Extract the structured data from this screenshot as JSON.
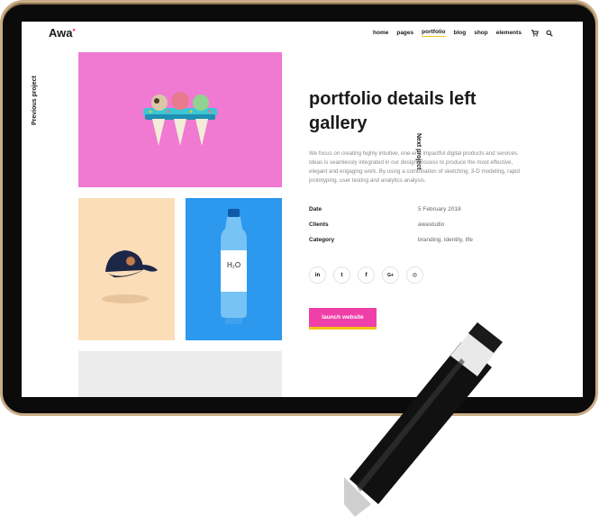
{
  "header": {
    "logo_text": "Awa",
    "logo_dot": "•",
    "nav": [
      "home",
      "pages",
      "portfolio",
      "blog",
      "shop",
      "elements"
    ],
    "active_nav": "portfolio",
    "icons": [
      "cart-icon",
      "search-icon"
    ]
  },
  "side": {
    "previous": "Previous project",
    "next": "Next project"
  },
  "detail": {
    "title": "portfolio details left gallery",
    "description": "We focus on creating highly intuitive, one-end impactful digital products and services. Ideas is seamlessly integrated in our design process to produce the most effective, elegant and engaging work. By using a combination of sketching, 3-D modeling, rapid prototyping, user testing and analytics analysis.",
    "info": [
      {
        "label": "Date",
        "value": "5 February 2018"
      },
      {
        "label": "Clients",
        "value": "awastudio"
      },
      {
        "label": "Category",
        "value": "branding, identity, life"
      }
    ],
    "social": [
      "linkedin-icon",
      "twitter-icon",
      "facebook-icon",
      "google-plus-icon",
      "instagram-icon"
    ],
    "social_glyphs": [
      "in",
      "t",
      "f",
      "G+",
      "◎"
    ],
    "launch_label": "launch website"
  },
  "images": {
    "bottle_text": "H₂O"
  },
  "colors": {
    "accent_pink": "#f03fa8",
    "accent_yellow": "#f5c518",
    "pink_tile": "#f079d2",
    "peach_tile": "#fbddb8",
    "blue_tile": "#2c98ee",
    "frame_gold": "#c9ad86"
  }
}
